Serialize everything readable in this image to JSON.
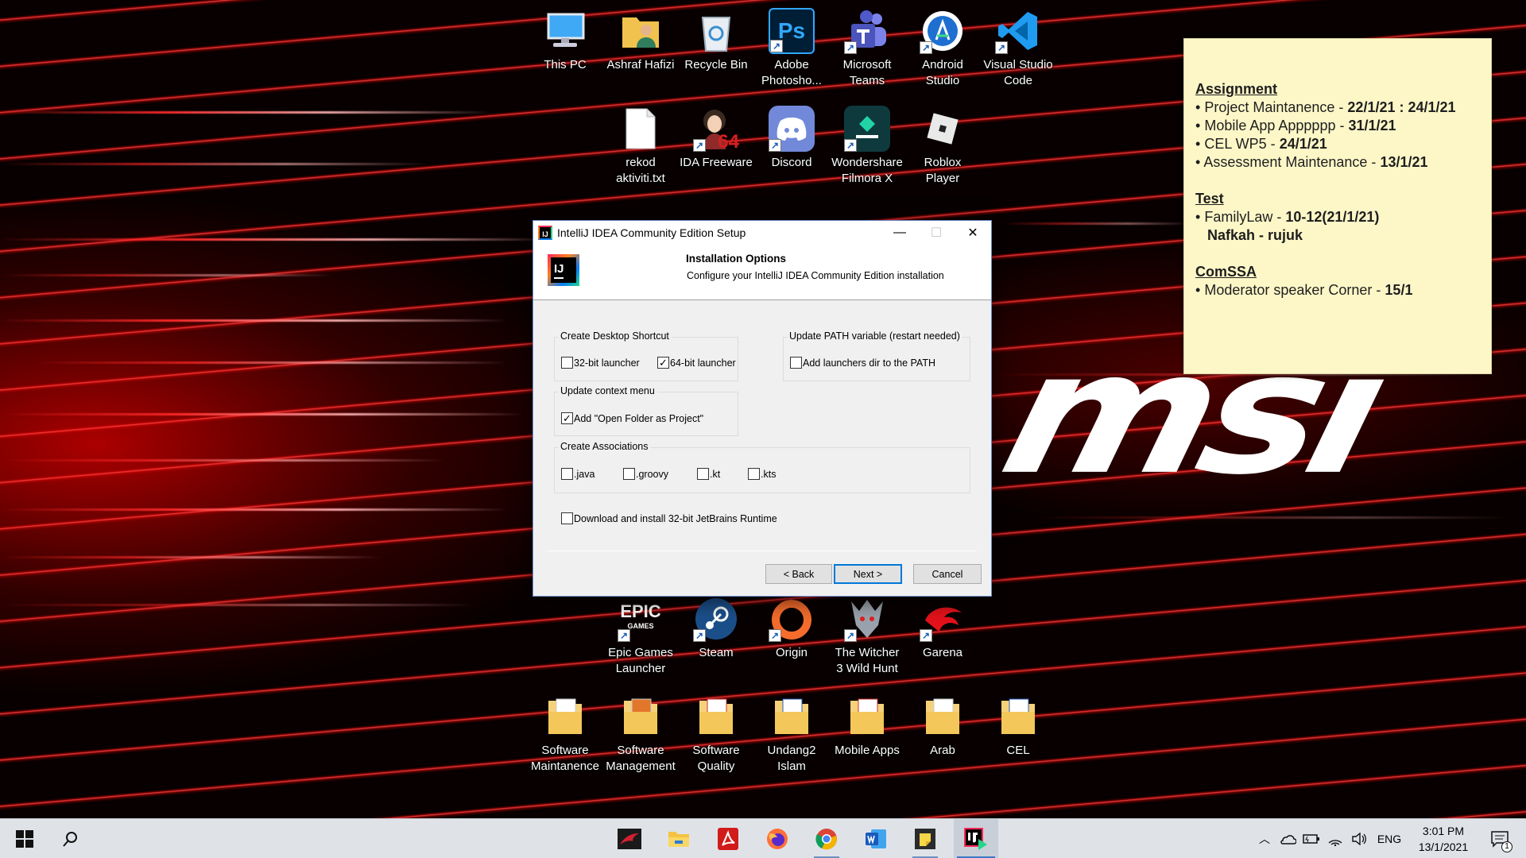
{
  "desktop": {
    "icons_row1": [
      {
        "label": "This PC",
        "icon": "this-pc-icon"
      },
      {
        "label": "Ashraf Hafizi",
        "icon": "user-folder-icon"
      },
      {
        "label": "Recycle Bin",
        "icon": "recycle-bin-icon"
      },
      {
        "label": "Adobe Photosho...",
        "icon": "photoshop-icon"
      },
      {
        "label": "Microsoft Teams",
        "icon": "teams-icon"
      },
      {
        "label": "Android Studio",
        "icon": "android-studio-icon"
      },
      {
        "label": "Visual Studio Code",
        "icon": "vscode-icon"
      }
    ],
    "icons_row2": [
      {
        "label": "rekod aktiviti.txt",
        "icon": "text-file-icon"
      },
      {
        "label": "IDA Freeware",
        "icon": "ida-icon"
      },
      {
        "label": "Discord",
        "icon": "discord-icon"
      },
      {
        "label": "Wondershare Filmora X",
        "icon": "filmora-icon"
      },
      {
        "label": "Roblox Player",
        "icon": "roblox-icon"
      }
    ],
    "icons_row3": [
      {
        "label": "Epic Games Launcher",
        "icon": "epic-games-icon"
      },
      {
        "label": "Steam",
        "icon": "steam-icon"
      },
      {
        "label": "Origin",
        "icon": "origin-icon"
      },
      {
        "label": "The Witcher 3 Wild Hunt",
        "icon": "witcher-icon"
      },
      {
        "label": "Garena",
        "icon": "garena-icon"
      }
    ],
    "icons_row4": [
      {
        "label": "Software Maintanence",
        "icon": "folder-icon"
      },
      {
        "label": "Software Management",
        "icon": "folder-icon"
      },
      {
        "label": "Software Quality",
        "icon": "folder-icon"
      },
      {
        "label": "Undang2 Islam",
        "icon": "folder-icon"
      },
      {
        "label": "Mobile Apps",
        "icon": "folder-icon"
      },
      {
        "label": "Arab",
        "icon": "folder-icon"
      },
      {
        "label": "CEL",
        "icon": "folder-icon"
      }
    ],
    "epic_glyph": "EPIC",
    "epic_glyph_sub": "GAMES",
    "ps_glyph": "Ps",
    "ida_glyph": "64",
    "wallpaper_logo": "msi"
  },
  "sticky_note": {
    "assignment_heading": "Assignment",
    "assignment": [
      {
        "text": "Project Maintanence  - ",
        "bold": "22/1/21 : 24/1/21"
      },
      {
        "text": "Mobile App Apppppp - ",
        "bold": "31/1/21"
      },
      {
        "text": "CEL WP5 - ",
        "bold": "24/1/21"
      },
      {
        "text": "Assessment Maintenance - ",
        "bold": "13/1/21"
      }
    ],
    "test_heading": "Test",
    "test": [
      {
        "text": "FamilyLaw - ",
        "bold": "10-12(21/1/21)"
      }
    ],
    "test_sub": "Nafkah - rujuk",
    "comssa_heading": "ComSSA",
    "comssa": [
      {
        "text": "Moderator speaker Corner - ",
        "bold": "15/1"
      }
    ],
    "bullet": "•"
  },
  "dialog": {
    "title": "IntelliJ IDEA Community Edition Setup",
    "app_icon_text": "IJ",
    "header_title": "Installation Options",
    "header_subtitle": "Configure your IntelliJ IDEA Community Edition installation",
    "groups": {
      "shortcut_legend": "Create Desktop Shortcut",
      "path_legend": "Update PATH variable (restart needed)",
      "context_legend": "Update context menu",
      "assoc_legend": "Create Associations"
    },
    "options": {
      "launcher32": {
        "label": "32-bit launcher",
        "checked": false
      },
      "launcher64": {
        "label": "64-bit launcher",
        "checked": true
      },
      "path": {
        "label": "Add launchers dir to the PATH",
        "checked": false
      },
      "open_folder": {
        "label": "Add \"Open Folder as Project\"",
        "checked": true
      },
      "java": {
        "label": ".java",
        "checked": false
      },
      "groovy": {
        "label": ".groovy",
        "checked": false
      },
      "kt": {
        "label": ".kt",
        "checked": false
      },
      "kts": {
        "label": ".kts",
        "checked": false
      },
      "runtime": {
        "label": "Download and install 32-bit JetBrains Runtime",
        "checked": false
      }
    },
    "buttons": {
      "back": "< Back",
      "next": "Next >",
      "cancel": "Cancel"
    }
  },
  "taskbar": {
    "language": "ENG",
    "time": "3:01 PM",
    "date": "13/1/2021",
    "notification_count": "1"
  }
}
